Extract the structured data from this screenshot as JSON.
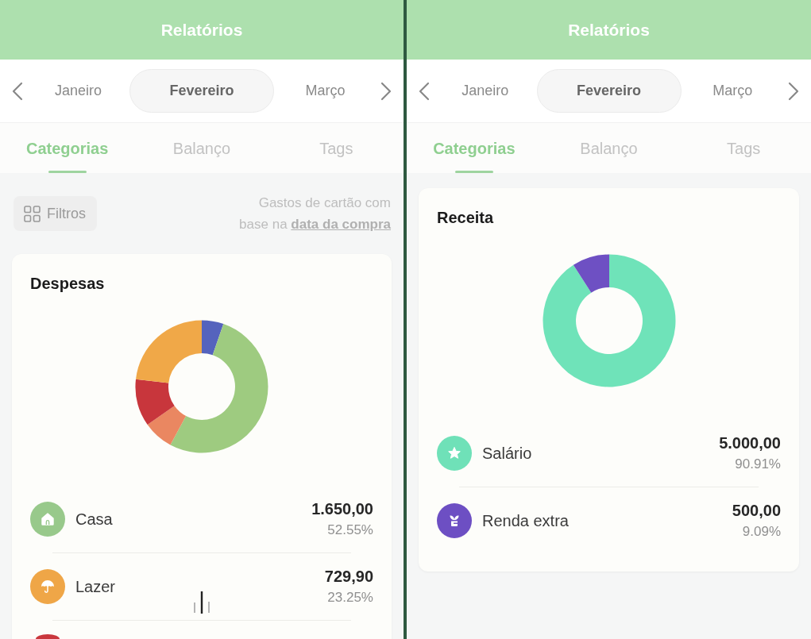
{
  "panels": [
    {
      "header": {
        "title": "Relatórios"
      },
      "months": [
        {
          "label": "Janeiro",
          "selected": false
        },
        {
          "label": "Fevereiro",
          "selected": true
        },
        {
          "label": "Março",
          "selected": false
        }
      ],
      "tabs": [
        {
          "label": "Categorias",
          "selected": true
        },
        {
          "label": "Balanço",
          "selected": false
        },
        {
          "label": "Tags",
          "selected": false
        }
      ],
      "filters": {
        "button": "Filtros",
        "note": "Gastos de cartão com base na",
        "note_link": "data da compra"
      },
      "card": {
        "title": "Despesas",
        "items": [
          {
            "name": "Casa",
            "amount": "1.650,00",
            "percent": "52.55%",
            "color": "#98c98b"
          },
          {
            "name": "Lazer",
            "amount": "729,90",
            "percent": "23.25%",
            "color": "#efa647"
          },
          {
            "color": "#c9373d"
          }
        ]
      }
    },
    {
      "header": {
        "title": "Relatórios"
      },
      "months": [
        {
          "label": "Janeiro",
          "selected": false
        },
        {
          "label": "Fevereiro",
          "selected": true
        },
        {
          "label": "Março",
          "selected": false
        }
      ],
      "tabs": [
        {
          "label": "Categorias",
          "selected": true
        },
        {
          "label": "Balanço",
          "selected": false
        },
        {
          "label": "Tags",
          "selected": false
        }
      ],
      "card": {
        "title": "Receita",
        "items": [
          {
            "name": "Salário",
            "amount": "5.000,00",
            "percent": "90.91%",
            "color": "#6fe1b8"
          },
          {
            "name": "Renda extra",
            "amount": "500,00",
            "percent": "9.09%",
            "color": "#6d4fc3"
          }
        ]
      }
    }
  ]
}
